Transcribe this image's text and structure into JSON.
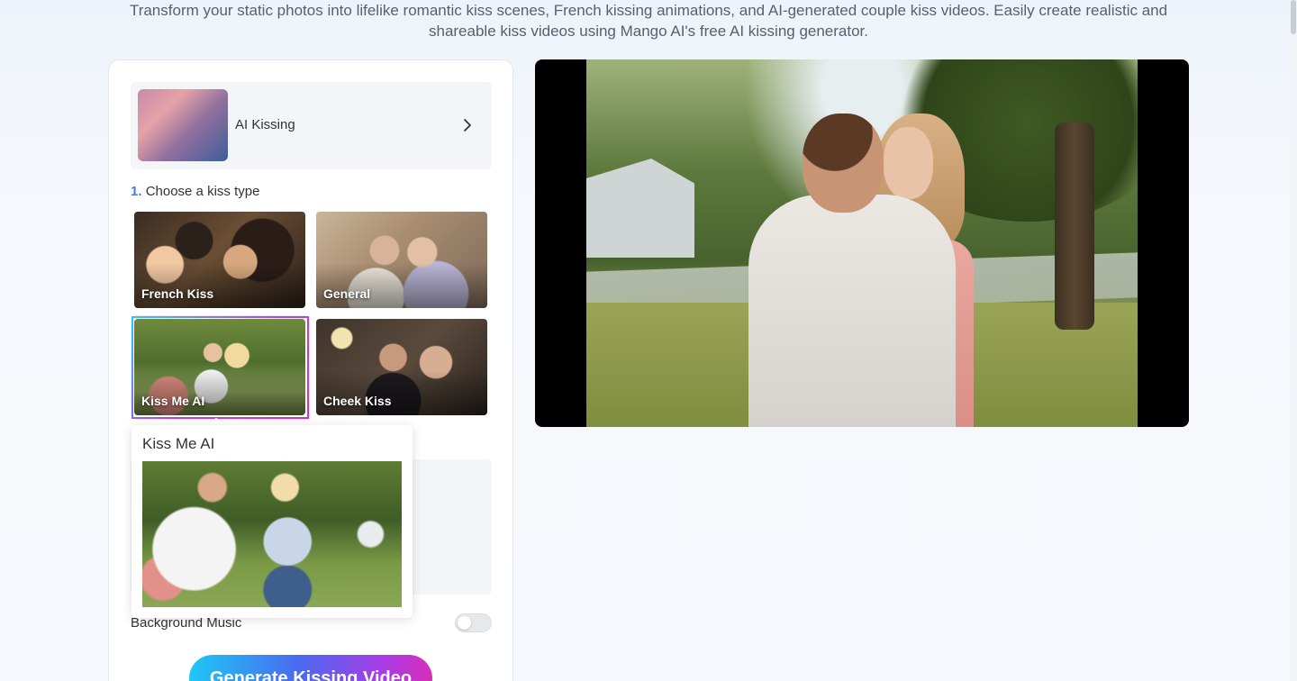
{
  "intro": {
    "line1": "Transform your static photos into lifelike romantic kiss scenes, French kissing animations, and AI-generated couple kiss videos. Easily create realistic and",
    "line2": "shareable kiss videos using Mango AI's free AI kissing generator."
  },
  "template": {
    "title": "AI Kissing",
    "chevron_icon": "chevron-right-icon"
  },
  "step1": {
    "number": "1.",
    "label": "Choose a kiss type"
  },
  "kiss_types": [
    {
      "label": "French Kiss",
      "selected": false
    },
    {
      "label": "General",
      "selected": false
    },
    {
      "label": "Kiss Me AI",
      "selected": true
    },
    {
      "label": "Cheek Kiss",
      "selected": false
    }
  ],
  "popover": {
    "title": "Kiss Me AI"
  },
  "music": {
    "label": "Background Music",
    "enabled": false
  },
  "generate": {
    "label": "Generate Kissing Video"
  },
  "colors": {
    "accent_step": "#4a7be0",
    "button_gradient": [
      "#1ec8f5",
      "#4a6af0",
      "#a93be6",
      "#d82fb8"
    ],
    "selected_ring": [
      "#2fc7f0",
      "#a94ae0",
      "#d233b4"
    ]
  }
}
